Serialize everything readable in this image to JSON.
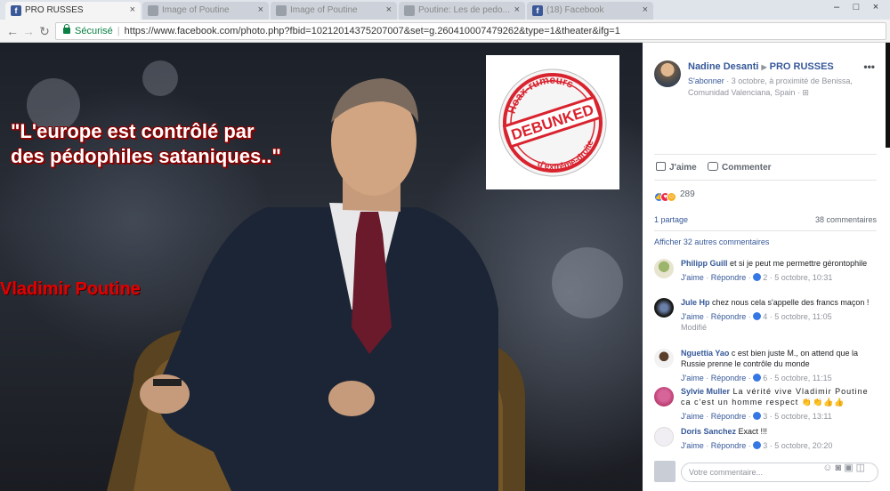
{
  "browser": {
    "tabs": [
      {
        "label": "PRO RUSSES",
        "active": true
      },
      {
        "label": "Image of Poutine",
        "active": false
      },
      {
        "label": "Image of Poutine",
        "active": false
      },
      {
        "label": "Poutine: Les de pedo...",
        "active": false
      },
      {
        "label": "(18) Facebook",
        "active": false
      }
    ],
    "secure_label": "Sécurisé",
    "url": "https://www.facebook.com/photo.php?fbid=10212014375207007&set=g.260410007479262&type=1&theater&ifg=1"
  },
  "photo": {
    "quote_line1": "\"L'europe est contrôlé par",
    "quote_line2": "des pédophiles sataniques..\"",
    "person_label": "Vladimir Poutine",
    "stamp": {
      "top_text": "Hoax-rumeurs",
      "center_text": "DEBUNKED",
      "bottom_text": "d'extrême-droite"
    }
  },
  "post": {
    "author": "Nadine Desanti",
    "group": "PRO RUSSES",
    "subscribe": "S'abonner",
    "meta": " · 3 octobre, à proximité de Benissa, Comunidad Valenciana, Spain · ",
    "like_label": "J'aime",
    "comment_label": "Commenter",
    "reaction_count": "289",
    "shares": "1 partage",
    "comment_count": "38 commentaires",
    "more_comments": "Afficher 32 autres commentaires",
    "composer_placeholder": "Votre commentaire..."
  },
  "comments": [
    {
      "name": "Philipp Guill",
      "text": " et si je peut me permettre gérontophile",
      "like": "J'aime",
      "reply": "Répondre",
      "likes": "2",
      "date": "5 octobre, 10:31",
      "modified": ""
    },
    {
      "name": "Jule Hp",
      "text": " chez nous cela s'appelle des francs maçon !",
      "like": "J'aime",
      "reply": "Répondre",
      "likes": "4",
      "date": "5 octobre, 11:05",
      "modified": "Modifié"
    },
    {
      "name": "Nguettia Yao",
      "text": " c est bien juste M., on attend que la Russie prenne le contrôle du monde",
      "like": "J'aime",
      "reply": "Répondre",
      "likes": "6",
      "date": "5 octobre, 11:15",
      "modified": ""
    },
    {
      "name": "Sylvie Muller",
      "text": " La vérité vive Vladimir Poutine ca c'est un homme respect 👏👏👍👍",
      "like": "J'aime",
      "reply": "Répondre",
      "likes": "3",
      "date": "5 octobre, 13:11",
      "modified": ""
    },
    {
      "name": "Doris Sanchez",
      "text": " Exact !!!",
      "like": "J'aime",
      "reply": "Répondre",
      "likes": "3",
      "date": "5 octobre, 20:20",
      "modified": ""
    }
  ],
  "colors": {
    "facebook_blue": "#365899",
    "quote_shadow": "#8b0000",
    "label_red": "#e30000",
    "stamp_red": "#d9232e"
  },
  "icons": [
    "facebook-favicon",
    "back-arrow-icon",
    "forward-arrow-icon",
    "reload-icon",
    "lock-icon",
    "more-dots-icon",
    "like-thumb-icon",
    "comment-bubble-icon",
    "emoji-icon",
    "camera-icon",
    "gif-icon",
    "sticker-icon"
  ]
}
